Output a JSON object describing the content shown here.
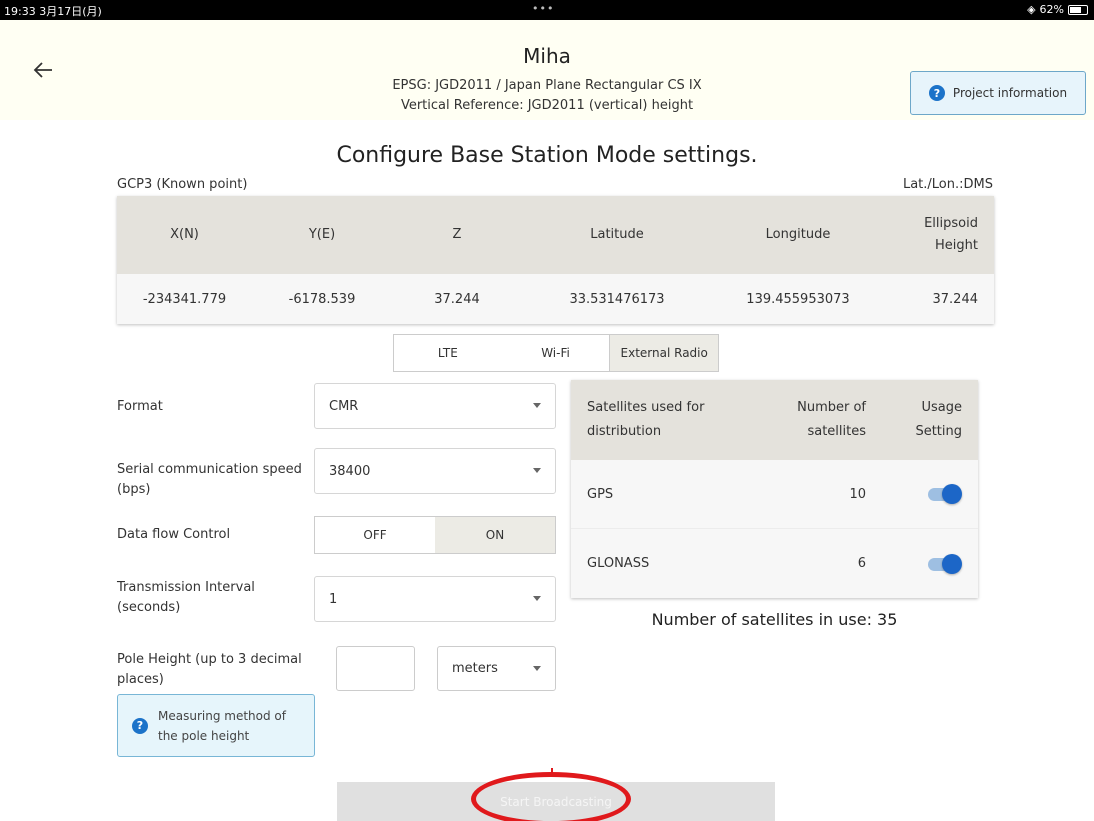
{
  "status_bar": {
    "time": "19:33 3月17日(月)",
    "dots": "•••",
    "battery": "62%"
  },
  "header": {
    "title": "Miha",
    "epsg": "EPSG: JGD2011 / Japan Plane Rectangular CS IX",
    "vertical": "Vertical Reference: JGD2011 (vertical) height",
    "project_info_label": "Project information"
  },
  "page": {
    "heading": "Configure Base Station Mode settings.",
    "gcp_label": "GCP3 (Known point)",
    "latlon_format": "Lat./Lon.:DMS"
  },
  "gcp_table": {
    "headers": [
      "X(N)",
      "Y(E)",
      "Z",
      "Latitude",
      "Longitude",
      "Ellipsoid Height"
    ],
    "header_ellipsoid_line1": "Ellipsoid",
    "header_ellipsoid_line2": "Height",
    "row": [
      "-234341.779",
      "-6178.539",
      "37.244",
      "33.531476173",
      "139.455953073",
      "37.244"
    ]
  },
  "comm_tabs": [
    {
      "label": "LTE",
      "active": false
    },
    {
      "label": "Wi-Fi",
      "active": false
    },
    {
      "label": "External Radio",
      "active": true
    }
  ],
  "form": {
    "format_label": "Format",
    "format_value": "CMR",
    "serial_label_1": "Serial communication speed",
    "serial_label_2": "(bps)",
    "serial_value": "38400",
    "flow_label": "Data flow Control",
    "flow_off": "OFF",
    "flow_on": "ON",
    "flow_selected": "ON",
    "interval_label_1": "Transmission Interval",
    "interval_label_2": "(seconds)",
    "interval_value": "1",
    "pole_label_1": "Pole Height (up to 3 decimal",
    "pole_label_2": "places)",
    "pole_value": "",
    "pole_units": "meters",
    "measure_label_1": "Measuring method of",
    "measure_label_2": "the pole height"
  },
  "satellites": {
    "header_used_1": "Satellites used for",
    "header_used_2": "distribution",
    "header_count_1": "Number of",
    "header_count_2": "satellites",
    "header_usage_1": "Usage",
    "header_usage_2": "Setting",
    "rows": [
      {
        "name": "GPS",
        "count": "10",
        "enabled": true
      },
      {
        "name": "GLONASS",
        "count": "6",
        "enabled": true
      }
    ],
    "in_use_text": "Number of satellites in use: 35"
  },
  "footer": {
    "start_label": "Start Broadcasting"
  },
  "colors": {
    "accent": "#1c66c7",
    "highlight": "#e0191c",
    "table_header": "#e4e2dc"
  }
}
